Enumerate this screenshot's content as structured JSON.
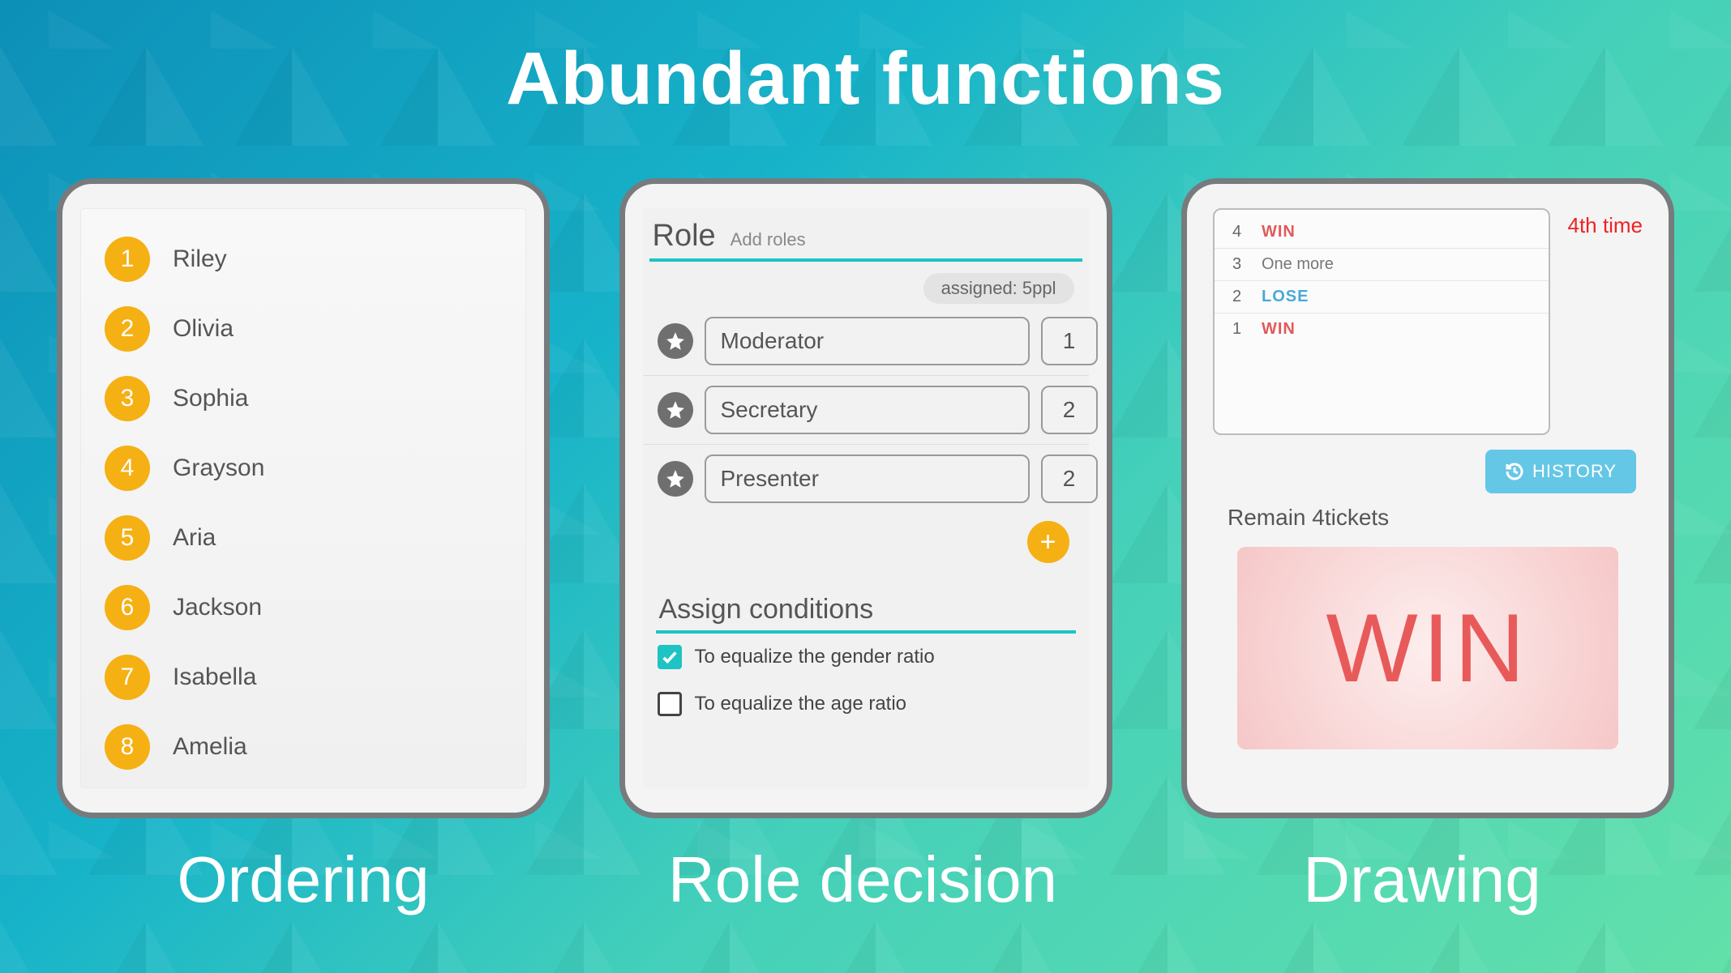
{
  "title": "Abundant functions",
  "subtitles": [
    "Ordering",
    "Role decision",
    "Drawing"
  ],
  "ordering": {
    "items": [
      {
        "num": "1",
        "name": "Riley"
      },
      {
        "num": "2",
        "name": "Olivia"
      },
      {
        "num": "3",
        "name": "Sophia"
      },
      {
        "num": "4",
        "name": "Grayson"
      },
      {
        "num": "5",
        "name": "Aria"
      },
      {
        "num": "6",
        "name": "Jackson"
      },
      {
        "num": "7",
        "name": "Isabella"
      },
      {
        "num": "8",
        "name": "Amelia"
      }
    ]
  },
  "role": {
    "heading": "Role",
    "sub": "Add roles",
    "assigned": "assigned: 5ppl",
    "rows": [
      {
        "label": "Moderator",
        "count": "1"
      },
      {
        "label": "Secretary",
        "count": "2"
      },
      {
        "label": "Presenter",
        "count": "2"
      }
    ],
    "ppl_suffix": "ppl",
    "add": "+",
    "cond_heading": "Assign conditions",
    "conditions": [
      {
        "label": "To equalize the gender ratio",
        "checked": true
      },
      {
        "label": "To equalize the age ratio",
        "checked": false
      }
    ]
  },
  "drawing": {
    "time": "4th time",
    "history": [
      {
        "n": "4",
        "result": "WIN",
        "kind": "win"
      },
      {
        "n": "3",
        "result": "One more",
        "kind": "more"
      },
      {
        "n": "2",
        "result": "LOSE",
        "kind": "lose"
      },
      {
        "n": "1",
        "result": "WIN",
        "kind": "win"
      }
    ],
    "history_btn": "HISTORY",
    "remain": "Remain 4tickets",
    "big": "WIN"
  }
}
